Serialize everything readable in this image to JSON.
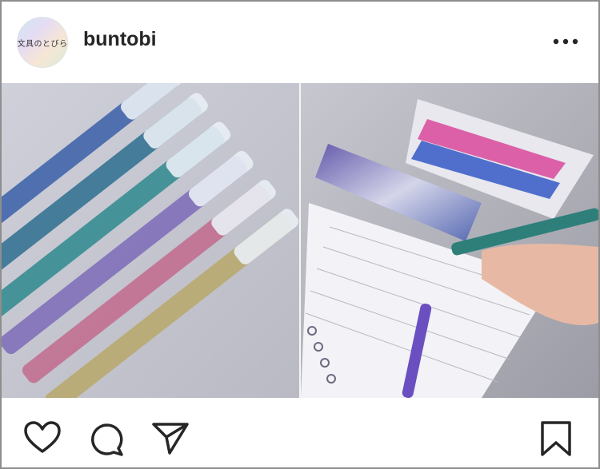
{
  "post": {
    "username": "buntobi",
    "avatar_text": "文具のとびら",
    "more_icon": "more-horizontal-icon"
  },
  "actions": {
    "icons": [
      "heart-icon",
      "comment-icon",
      "share-icon",
      "bookmark-icon"
    ]
  },
  "colors": {
    "text": "#262626",
    "border": "#8e8e8e",
    "background": "#ffffff"
  }
}
